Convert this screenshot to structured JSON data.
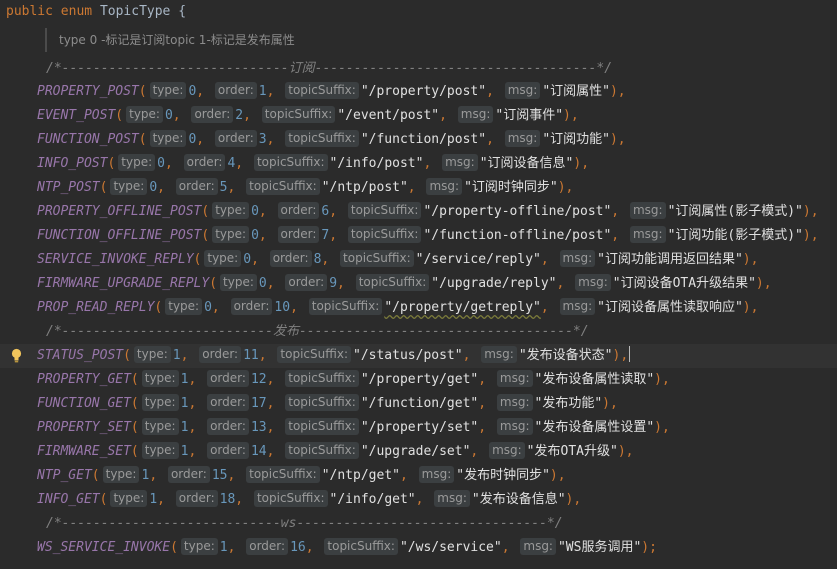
{
  "header": {
    "keyword_public": "public",
    "keyword_enum": "enum",
    "type_name": "TopicType",
    "brace": "{"
  },
  "doc_comment": "type 0 -标记是订阅topic 1-标记是发布属性",
  "separators": {
    "subscribe": "/*-----------------------------订阅------------------------------------*/",
    "publish": "/*---------------------------发布-----------------------------------*/",
    "ws": "/*----------------------------ws--------------------------------*/"
  },
  "hint_labels": {
    "type": "type:",
    "order": "order:",
    "topicSuffix": "topicSuffix:",
    "msg": "msg:"
  },
  "entries": [
    {
      "name": "PROPERTY_POST",
      "type": "0",
      "order": "1",
      "suffix": "\"/property/post\"",
      "msg": "\"订阅属性\""
    },
    {
      "name": "EVENT_POST",
      "type": "0",
      "order": "2",
      "suffix": "\"/event/post\"",
      "msg": "\"订阅事件\""
    },
    {
      "name": "FUNCTION_POST",
      "type": "0",
      "order": "3",
      "suffix": "\"/function/post\"",
      "msg": "\"订阅功能\""
    },
    {
      "name": "INFO_POST",
      "type": "0",
      "order": "4",
      "suffix": "\"/info/post\"",
      "msg": "\"订阅设备信息\""
    },
    {
      "name": "NTP_POST",
      "type": "0",
      "order": "5",
      "suffix": "\"/ntp/post\"",
      "msg": "\"订阅时钟同步\""
    },
    {
      "name": "PROPERTY_OFFLINE_POST",
      "type": "0",
      "order": "6",
      "suffix": "\"/property-offline/post\"",
      "msg": "\"订阅属性(影子模式)\""
    },
    {
      "name": "FUNCTION_OFFLINE_POST",
      "type": "0",
      "order": "7",
      "suffix": "\"/function-offline/post\"",
      "msg": "\"订阅功能(影子模式)\""
    },
    {
      "name": "SERVICE_INVOKE_REPLY",
      "type": "0",
      "order": "8",
      "suffix": "\"/service/reply\"",
      "msg": "\"订阅功能调用返回结果\""
    },
    {
      "name": "FIRMWARE_UPGRADE_REPLY",
      "type": "0",
      "order": "9",
      "suffix": "\"/upgrade/reply\"",
      "msg": "\"订阅设备OTA升级结果\""
    },
    {
      "name": "PROP_READ_REPLY",
      "type": "0",
      "order": "10",
      "suffix": "\"/property/getreply\"",
      "msg": "\"订阅设备属性读取响应\""
    },
    {
      "name": "STATUS_POST",
      "type": "1",
      "order": "11",
      "suffix": "\"/status/post\"",
      "msg": "\"发布设备状态\""
    },
    {
      "name": "PROPERTY_GET",
      "type": "1",
      "order": "12",
      "suffix": "\"/property/get\"",
      "msg": "\"发布设备属性读取\""
    },
    {
      "name": "FUNCTION_GET",
      "type": "1",
      "order": "17",
      "suffix": "\"/function/get\"",
      "msg": "\"发布功能\""
    },
    {
      "name": "PROPERTY_SET",
      "type": "1",
      "order": "13",
      "suffix": "\"/property/set\"",
      "msg": "\"发布设备属性设置\""
    },
    {
      "name": "FIRMWARE_SET",
      "type": "1",
      "order": "14",
      "suffix": "\"/upgrade/set\"",
      "msg": "\"发布OTA升级\""
    },
    {
      "name": "NTP_GET",
      "type": "1",
      "order": "15",
      "suffix": "\"/ntp/get\"",
      "msg": "\"发布时钟同步\""
    },
    {
      "name": "INFO_GET",
      "type": "1",
      "order": "18",
      "suffix": "\"/info/get\"",
      "msg": "\"发布设备信息\""
    },
    {
      "name": "WS_SERVICE_INVOKE",
      "type": "1",
      "order": "16",
      "suffix": "\"/ws/service\"",
      "msg": "\"WS服务调用\""
    }
  ],
  "line_endings": {
    "comma": "),",
    "last": ");"
  },
  "colors": {
    "background": "#2b2b2b",
    "keyword": "#cc7832",
    "constant": "#9876aa",
    "number": "#6897bb",
    "string": "#6a8759",
    "comment": "#808080",
    "hint_bg": "#3b3f41",
    "bulb": "#f2c55c"
  }
}
